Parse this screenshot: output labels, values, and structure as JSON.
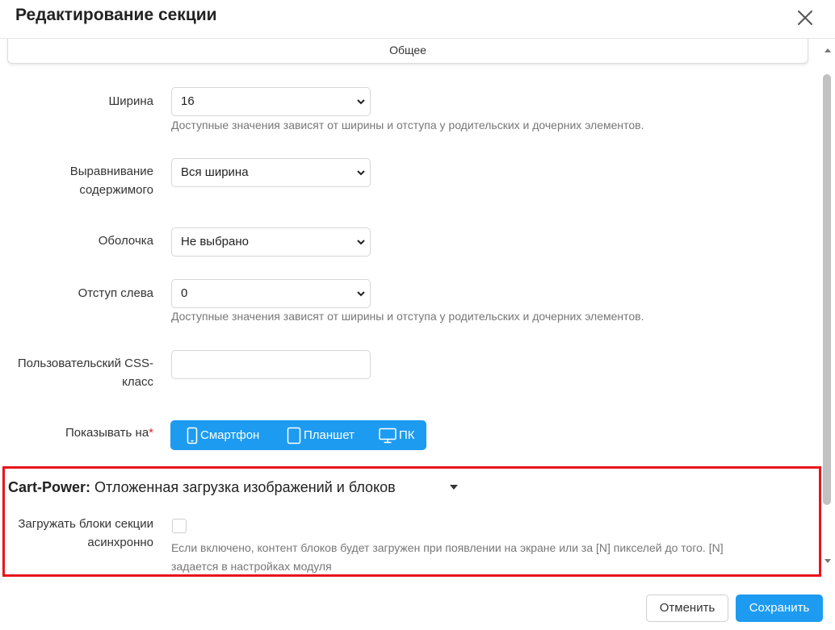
{
  "dialog": {
    "title": "Редактирование секции"
  },
  "tabs": {
    "general": "Общее"
  },
  "form": {
    "width": {
      "label": "Ширина",
      "value": "16",
      "help": "Доступные значения зависят от ширины и отступа у родительских и дочерних элементов."
    },
    "alignment": {
      "label_line1": "Выравнивание",
      "label_line2": "содержимого",
      "value": "Вся ширина"
    },
    "wrapper": {
      "label": "Оболочка",
      "value": "Не выбрано"
    },
    "offset_left": {
      "label": "Отступ слева",
      "value": "0",
      "help": "Доступные значения зависят от ширины и отступа у родительских и дочерних элементов."
    },
    "css_class": {
      "label_line1": "Пользовательский CSS-",
      "label_line2": "класс",
      "value": ""
    },
    "show_on": {
      "label": "Показывать на",
      "required_mark": "*",
      "devices": [
        {
          "label": "Смартфон",
          "icon": "smartphone-icon"
        },
        {
          "label": "Планшет",
          "icon": "tablet-icon"
        },
        {
          "label": "ПК",
          "icon": "monitor-icon"
        }
      ]
    }
  },
  "addon_section": {
    "title_brand": "Cart-Power:",
    "title_rest": " Отложенная загрузка изображений и блоков",
    "async_load": {
      "label_line1": "Загружать блоки секции",
      "label_line2": "асинхронно",
      "checked": false,
      "help_line1": "Если включено, контент блоков будет загружен при появлении на экране или за [N] пикселей до того. [N]",
      "help_line2": "задается в настройках модуля"
    }
  },
  "footer": {
    "cancel_label": "Отменить",
    "save_label": "Сохранить"
  },
  "colors": {
    "accent": "#1d9bf0",
    "highlight": "#e8141b"
  }
}
